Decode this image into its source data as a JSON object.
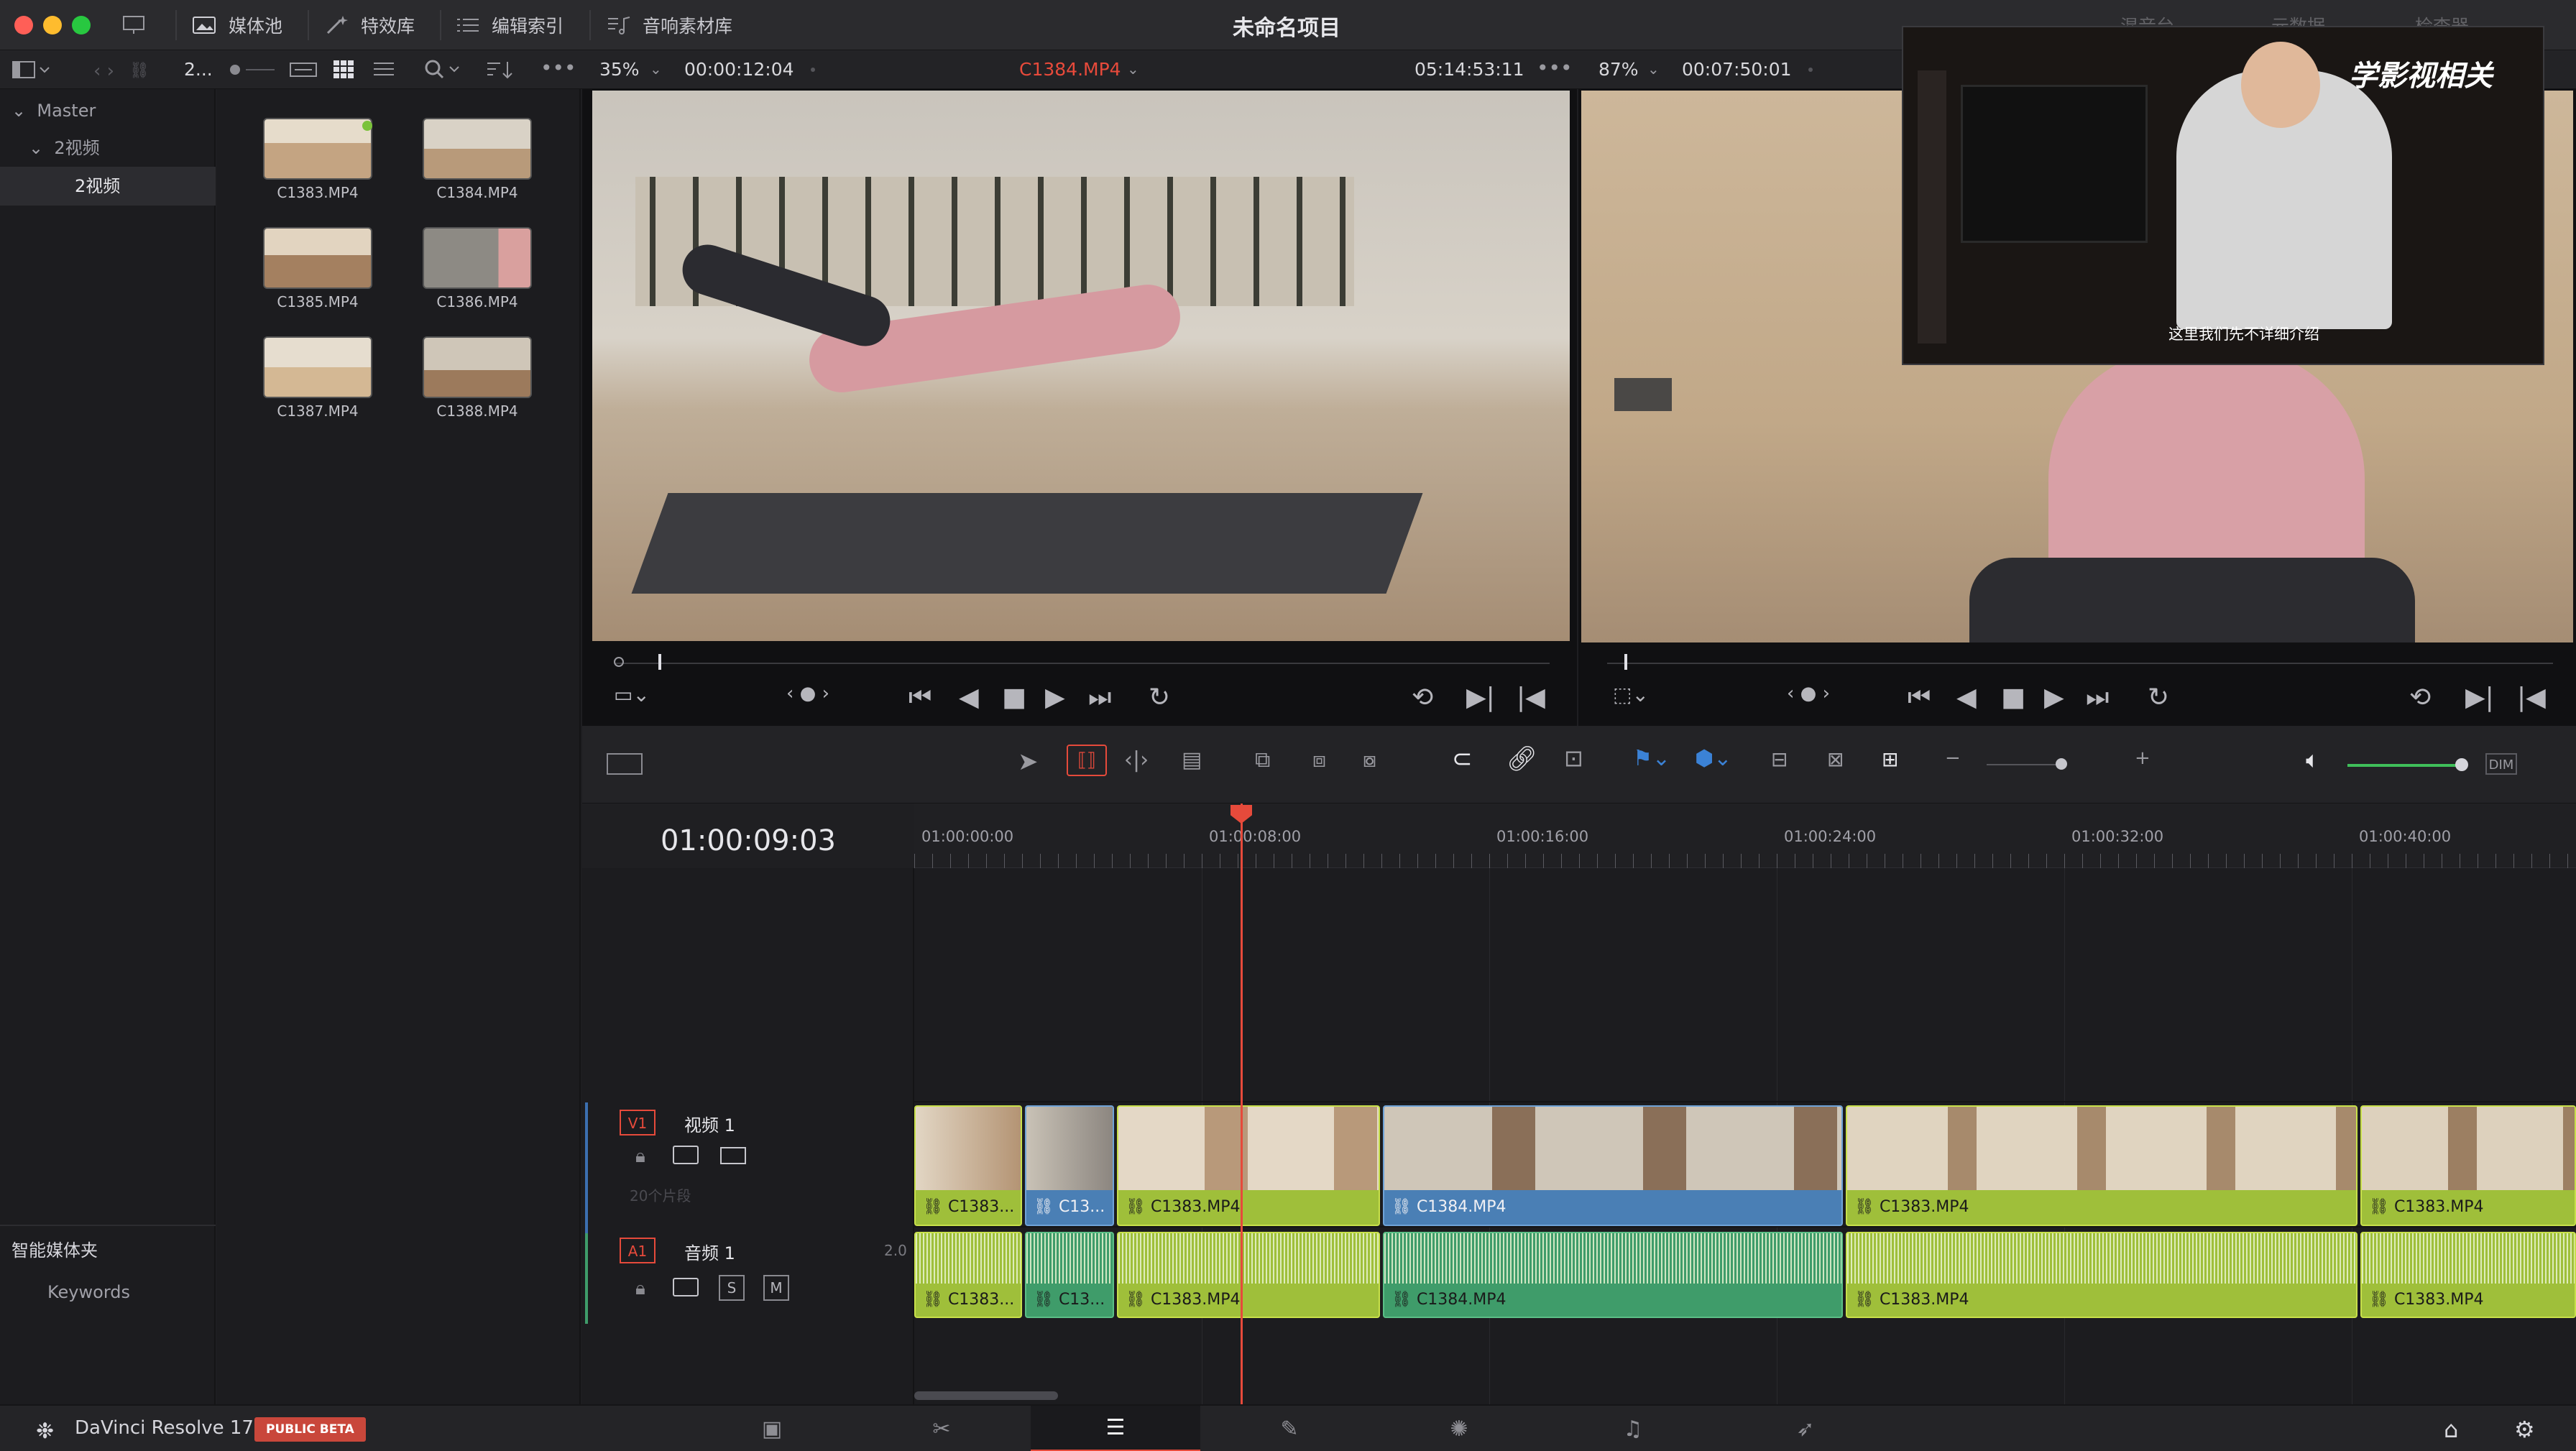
{
  "titlebar": {
    "tabs": [
      "媒体池",
      "特效库",
      "编辑索引",
      "音响素材库"
    ],
    "project_title": "未命名项目",
    "right_items": [
      "混音台",
      "元数据",
      "检查器"
    ]
  },
  "toolbar2": {
    "bin_path": "2...",
    "source_zoom": "35%",
    "source_tc": "00:00:12:04",
    "clip_name": "C1384.MP4",
    "clip_duration": "05:14:53:11",
    "program_zoom": "87%",
    "program_tc": "00:07:50:01"
  },
  "bins": {
    "master": "Master",
    "folder": "2视频",
    "selected": "2视频",
    "smart_bins": "智能媒体夹",
    "keywords": "Keywords"
  },
  "clips": [
    "C1383.MP4",
    "C1384.MP4",
    "C1385.MP4",
    "C1386.MP4",
    "C1387.MP4",
    "C1388.MP4"
  ],
  "overlay": {
    "caption": "这里我们先不详细介绍",
    "logo": "学影视相关"
  },
  "timeline": {
    "timecode": "01:00:09:03",
    "ruler": [
      "01:00:00:00",
      "01:00:08:00",
      "01:00:16:00",
      "01:00:24:00",
      "01:00:32:00",
      "01:00:40:00"
    ],
    "v1": {
      "id": "V1",
      "name": "视频 1",
      "count": "20个片段"
    },
    "a1": {
      "id": "A1",
      "name": "音频 1",
      "channels": "2.0",
      "s": "S",
      "m": "M"
    },
    "vclips": [
      {
        "label": "C1383...",
        "blue": false
      },
      {
        "label": "C13...",
        "blue": true
      },
      {
        "label": "C1383.MP4",
        "blue": false
      },
      {
        "label": "C1384.MP4",
        "blue": true
      },
      {
        "label": "C1383.MP4",
        "blue": false
      },
      {
        "label": "C1383.MP4",
        "blue": false
      }
    ],
    "aclips": [
      {
        "label": "C1383..."
      },
      {
        "label": "C13..."
      },
      {
        "label": "C1383.MP4"
      },
      {
        "label": "C1384.MP4"
      },
      {
        "label": "C1383.MP4"
      },
      {
        "label": "C1383.MP4"
      }
    ],
    "dim": "DIM"
  },
  "status": {
    "app": "DaVinci Resolve 17",
    "badge": "PUBLIC BETA"
  },
  "colors": {
    "accent_red": "#e64a3b",
    "clip_green": "#9fbf3a",
    "clip_blue": "#4a7fb5",
    "audio_green": "#3f9c6a"
  }
}
